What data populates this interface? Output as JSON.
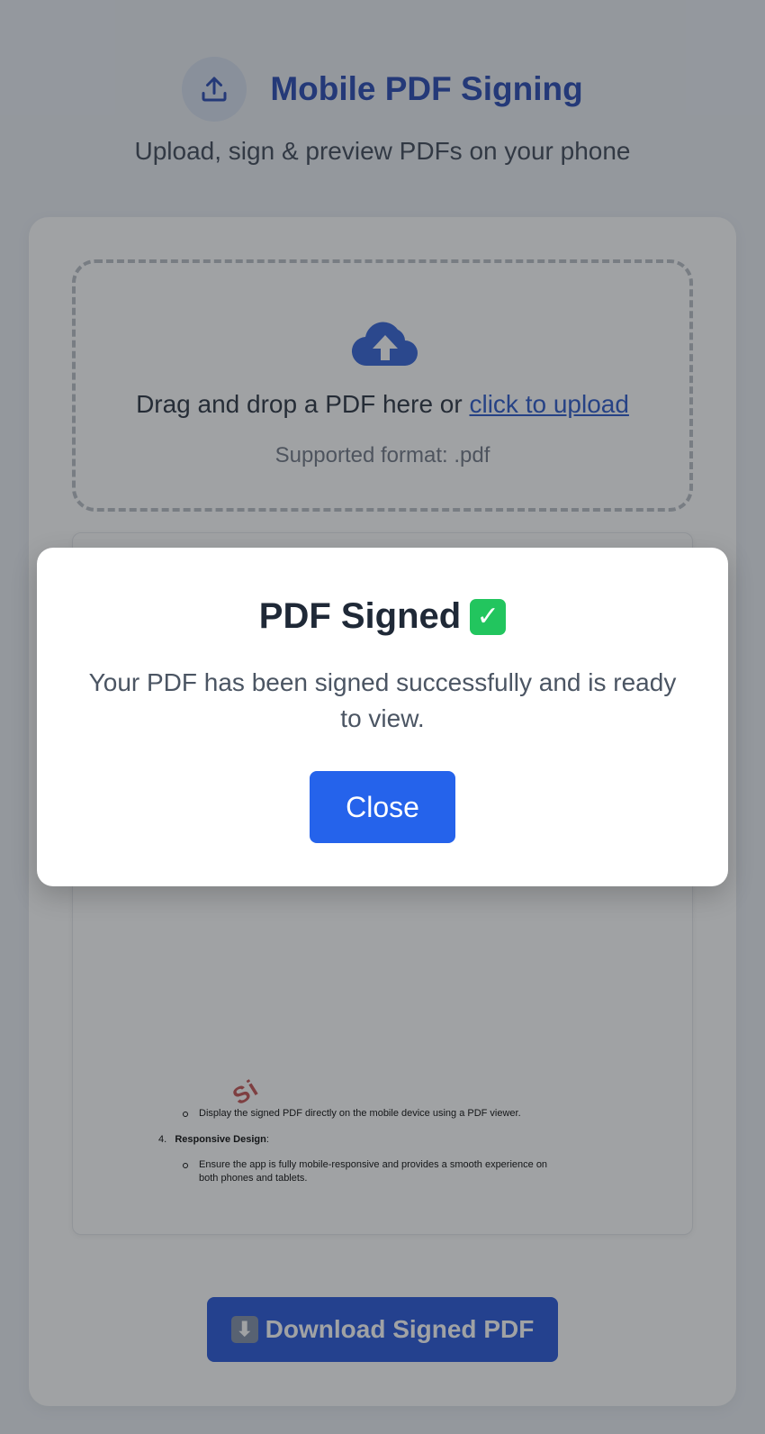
{
  "header": {
    "title": "Mobile PDF Signing",
    "subtitle": "Upload, sign & preview PDFs on your phone"
  },
  "dropzone": {
    "text": "Drag and drop a PDF here or ",
    "link": "click to upload",
    "supported": "Supported format: .pdf"
  },
  "preview": {
    "bullet_display": "Display the signed PDF directly on the mobile device using a PDF viewer.",
    "item4_number": "4.",
    "item4_title": "Responsive Design",
    "item4_colon": ":",
    "bullet_responsive_line1": "Ensure the app is fully mobile-responsive and provides a smooth experience on",
    "bullet_responsive_line2": "both phones and tablets.",
    "stamp": "Si"
  },
  "download": {
    "emoji": "⬇",
    "label": "Download Signed PDF"
  },
  "modal": {
    "title": "PDF Signed",
    "check_emoji": "✓",
    "text": "Your PDF has been signed successfully and is ready to view.",
    "close_label": "Close"
  },
  "colors": {
    "accent": "#2563eb",
    "brand": "#1e40af",
    "success": "#22c55e"
  }
}
